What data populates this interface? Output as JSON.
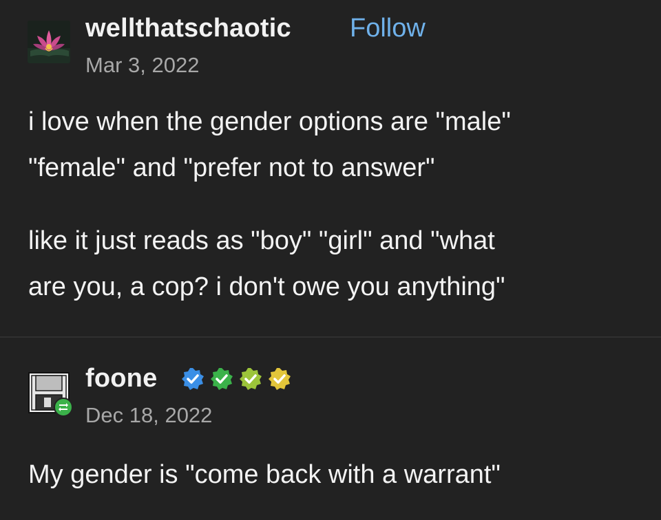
{
  "posts": [
    {
      "username": "wellthatschaotic",
      "follow_label": "Follow",
      "date": "Mar 3, 2022",
      "paragraphs": [
        [
          "i love when the gender options are \"male\"",
          "\"female\" and \"prefer not to answer\""
        ],
        [
          "like it just reads as \"boy\" \"girl\" and \"what",
          "are you, a cop? i don't owe you anything\""
        ]
      ],
      "avatar_icon": "lotus-flower-icon"
    },
    {
      "username": "foone",
      "date": "Dec 18, 2022",
      "paragraphs": [
        [
          "My gender is \"come back with a warrant\""
        ]
      ],
      "avatar_icon": "floppy-disk-icon",
      "avatar_badge_icon": "reblog-icon",
      "badges": [
        {
          "icon": "verified-badge-icon",
          "color": "#3b8fe6"
        },
        {
          "icon": "verified-badge-icon",
          "color": "#3bb24a"
        },
        {
          "icon": "verified-badge-icon",
          "color": "#9cc43a"
        },
        {
          "icon": "verified-badge-icon",
          "color": "#e2c53a"
        }
      ]
    }
  ],
  "colors": {
    "background": "#222222",
    "text": "#f3f3f3",
    "muted": "#a8a8a8",
    "link": "#6fb1ea",
    "reblog": "#3bb24a"
  }
}
